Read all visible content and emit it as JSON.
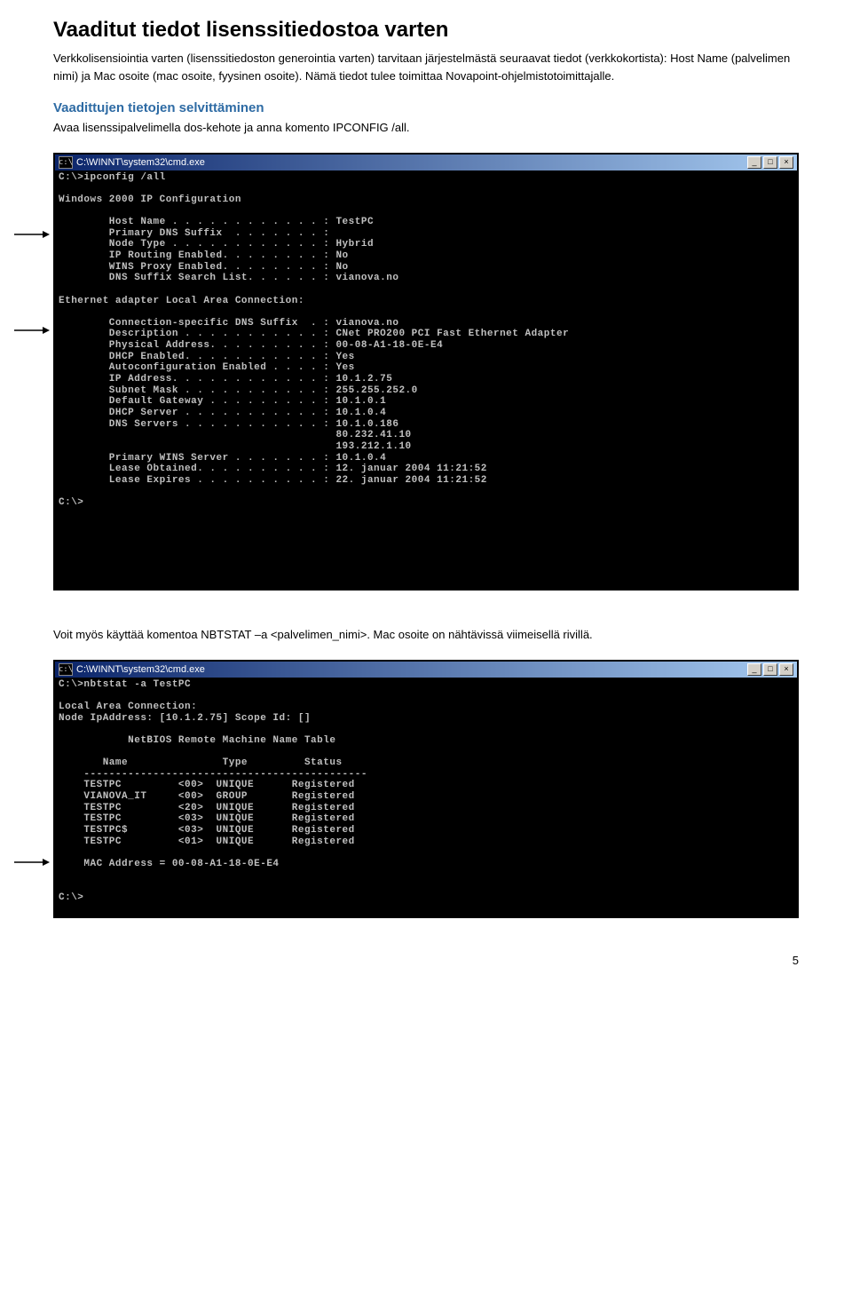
{
  "heading": "Vaaditut tiedot lisenssitiedostoa varten",
  "intro": "Verkkolisensiointia varten (lisenssitiedoston generointia varten) tarvitaan järjestelmästä seuraavat tiedot (verkkokortista): Host Name (palvelimen nimi) ja Mac osoite (mac osoite, fyysinen osoite). Nämä tiedot tulee toimittaa Novapoint-ohjelmistotoimittajalle.",
  "subheading": "Vaadittujen tietojen selvittäminen",
  "subtext": "Avaa lisenssipalvelimella dos-kehote ja anna komento IPCONFIG /all.",
  "cmd1_title": "C:\\WINNT\\system32\\cmd.exe",
  "cmd1_body": "C:\\>ipconfig /all\n\nWindows 2000 IP Configuration\n\n        Host Name . . . . . . . . . . . . : TestPC\n        Primary DNS Suffix  . . . . . . . :\n        Node Type . . . . . . . . . . . . : Hybrid\n        IP Routing Enabled. . . . . . . . : No\n        WINS Proxy Enabled. . . . . . . . : No\n        DNS Suffix Search List. . . . . . : vianova.no\n\nEthernet adapter Local Area Connection:\n\n        Connection-specific DNS Suffix  . : vianova.no\n        Description . . . . . . . . . . . : CNet PRO200 PCI Fast Ethernet Adapter\n        Physical Address. . . . . . . . . : 00-08-A1-18-0E-E4\n        DHCP Enabled. . . . . . . . . . . : Yes\n        Autoconfiguration Enabled . . . . : Yes\n        IP Address. . . . . . . . . . . . : 10.1.2.75\n        Subnet Mask . . . . . . . . . . . : 255.255.252.0\n        Default Gateway . . . . . . . . . : 10.1.0.1\n        DHCP Server . . . . . . . . . . . : 10.1.0.4\n        DNS Servers . . . . . . . . . . . : 10.1.0.186\n                                            80.232.41.10\n                                            193.212.1.10\n        Primary WINS Server . . . . . . . : 10.1.0.4\n        Lease Obtained. . . . . . . . . . : 12. januar 2004 11:21:52\n        Lease Expires . . . . . . . . . . : 22. januar 2004 11:21:52\n\nC:\\>\n\n\n\n\n\n\n\n",
  "between": "Voit myös käyttää komentoa NBTSTAT –a <palvelimen_nimi>. Mac osoite on nähtävissä viimeisellä rivillä.",
  "cmd2_title": "C:\\WINNT\\system32\\cmd.exe",
  "cmd2_body": "C:\\>nbtstat -a TestPC\n\nLocal Area Connection:\nNode IpAddress: [10.1.2.75] Scope Id: []\n\n           NetBIOS Remote Machine Name Table\n\n       Name               Type         Status\n    ---------------------------------------------\n    TESTPC         <00>  UNIQUE      Registered\n    VIANOVA_IT     <00>  GROUP       Registered\n    TESTPC         <20>  UNIQUE      Registered\n    TESTPC         <03>  UNIQUE      Registered\n    TESTPC$        <03>  UNIQUE      Registered\n    TESTPC         <01>  UNIQUE      Registered\n\n    MAC Address = 00-08-A1-18-0E-E4\n\n\nC:\\>\n\n",
  "page_number": "5"
}
